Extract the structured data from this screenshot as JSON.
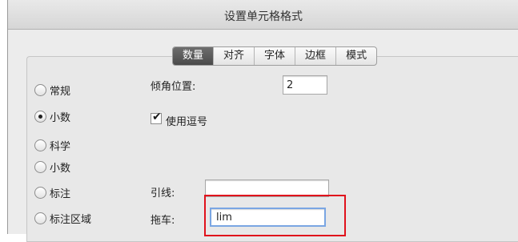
{
  "dialog": {
    "title": "设置单元格格式"
  },
  "tabs": [
    {
      "label": "数量",
      "active": true
    },
    {
      "label": "对齐"
    },
    {
      "label": "字体"
    },
    {
      "label": "边框"
    },
    {
      "label": "模式"
    }
  ],
  "categories": [
    {
      "label": "常规",
      "selected": false
    },
    {
      "label": "小数",
      "selected": true
    },
    {
      "label": "科学",
      "selected": false
    },
    {
      "label": "小数",
      "selected": false
    },
    {
      "label": "标注",
      "selected": false
    },
    {
      "label": "标注区域",
      "selected": false
    }
  ],
  "fields": {
    "decimal_places_label": "倾角位置:",
    "decimal_places_value": "2",
    "thousands_separator_label": "使用逗号",
    "thousands_separator_checked": true,
    "leader_label": "引线:",
    "leader_value": "",
    "trailer_label": "拖车:",
    "trailer_value": "lim"
  },
  "colors": {
    "highlight": "#e0121c",
    "active_tab": "#4a4a4a"
  },
  "icons": {
    "check": "checkmark-icon"
  }
}
